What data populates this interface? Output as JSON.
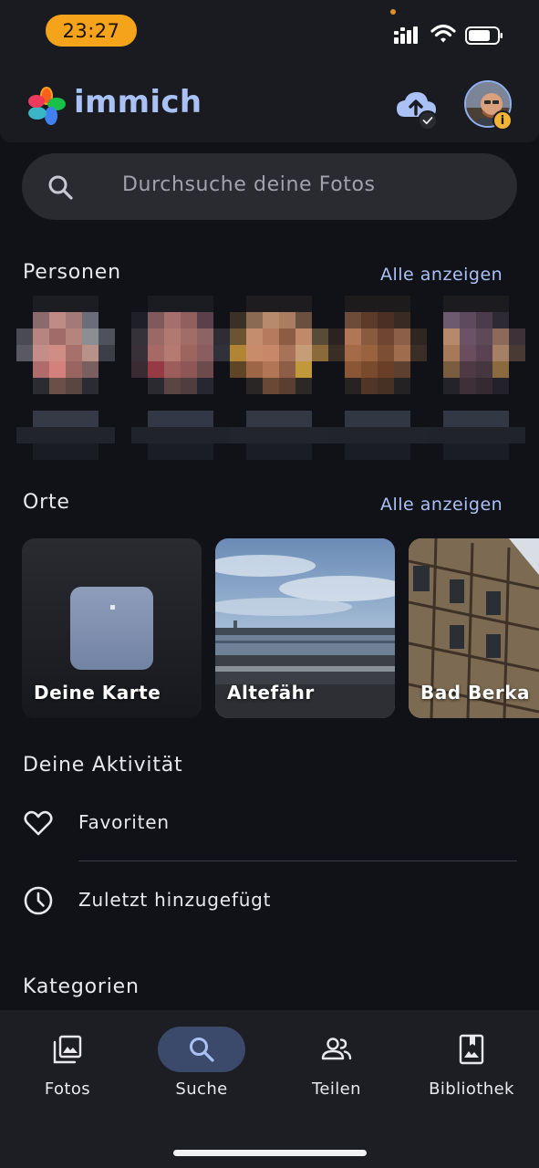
{
  "status_bar": {
    "time": "23:27"
  },
  "header": {
    "brand": "immich"
  },
  "search": {
    "placeholder": "Durchsuche deine Fotos"
  },
  "people": {
    "title": "Personen",
    "see_all": "Alle anzeigen"
  },
  "places": {
    "title": "Orte",
    "see_all": "Alle anzeigen",
    "items": [
      {
        "label": "Deine Karte"
      },
      {
        "label": "Altefähr"
      },
      {
        "label": "Bad Berka"
      }
    ]
  },
  "activity": {
    "title": "Deine Aktivität",
    "items": [
      {
        "label": "Favoriten",
        "icon": "heart-icon"
      },
      {
        "label": "Zuletzt hinzugefügt",
        "icon": "clock-icon"
      }
    ]
  },
  "categories": {
    "title": "Kategorien"
  },
  "bottom_nav": {
    "items": [
      {
        "label": "Fotos",
        "icon": "photos-icon"
      },
      {
        "label": "Suche",
        "icon": "search-icon",
        "active": true
      },
      {
        "label": "Teilen",
        "icon": "people-icon"
      },
      {
        "label": "Bibliothek",
        "icon": "library-icon"
      }
    ]
  },
  "colors": {
    "accent": "#a9c1f5",
    "background": "#111218",
    "status_pill": "#f5a31a"
  }
}
